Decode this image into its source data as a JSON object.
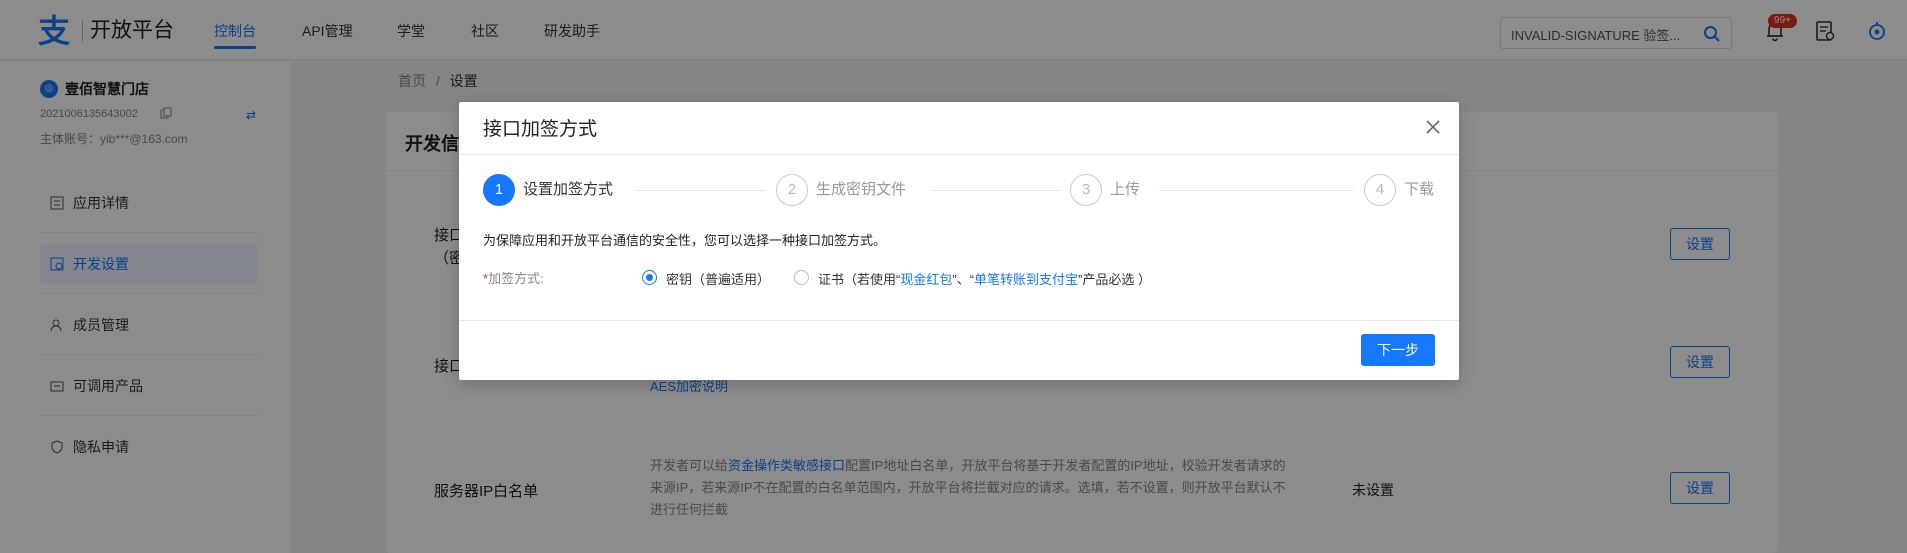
{
  "header": {
    "logo_text": "开放平台",
    "nav": [
      "控制台",
      "API管理",
      "学堂",
      "社区",
      "研发助手"
    ],
    "search": {
      "value": "INVALID-SIGNATURE 验签..."
    },
    "badge": "99+"
  },
  "sidebar": {
    "store_name": "壹佰智慧门店",
    "app_id": "2021006135643002",
    "account": "主体账号：yib***@163.com",
    "items": [
      "应用详情",
      "开发设置",
      "成员管理",
      "可调用产品",
      "隐私申请"
    ]
  },
  "breadcrumb": {
    "home": "首页",
    "sep": "/",
    "current": "设置"
  },
  "panel": {
    "title": "开发信",
    "rows": [
      {
        "title_a": "接口",
        "title_b": "（密",
        "button": "设置"
      },
      {
        "title": "接口",
        "link": "AES加密说明",
        "button": "设置"
      },
      {
        "title": "服务器IP白名单",
        "desc_pre": "开发者可以给",
        "desc_link": "资金操作类敏感接口",
        "desc_post": "配置IP地址白名单，开放平台将基于开发者配置的IP地址，校验开发者请求的来源IP，若来源IP不在配置的白名单范围内，开放平台将拦截对应的请求。选填，若不设置，则开放平台默认不进行任何拦截",
        "status": "未设置",
        "button": "设置"
      }
    ]
  },
  "modal": {
    "title": "接口加签方式",
    "steps": [
      {
        "num": "1",
        "label": "设置加签方式"
      },
      {
        "num": "2",
        "label": "生成密钥文件"
      },
      {
        "num": "3",
        "label": "上传"
      },
      {
        "num": "4",
        "label": "下载"
      }
    ],
    "intro": "为保障应用和开放平台通信的安全性，您可以选择一种接口加签方式。",
    "form_label_req": "*",
    "form_label": "加签方式:",
    "option_key": "密钥（普遍适用）",
    "option_cert_pre": "证书（若使用“",
    "option_cert_link1": "现金红包",
    "option_cert_mid": "”、“",
    "option_cert_link2": "单笔转账到支付宝",
    "option_cert_post": "”产品必选 ）",
    "next_button": "下一步"
  },
  "colors": {
    "accent": "#1677ff",
    "badge": "#e02e24",
    "overlay": "rgba(0,0,0,0.45)"
  },
  "icons": [
    "alipay-logo-icon",
    "search-icon",
    "bell-icon",
    "document-icon",
    "settings-icon",
    "close-icon"
  ]
}
